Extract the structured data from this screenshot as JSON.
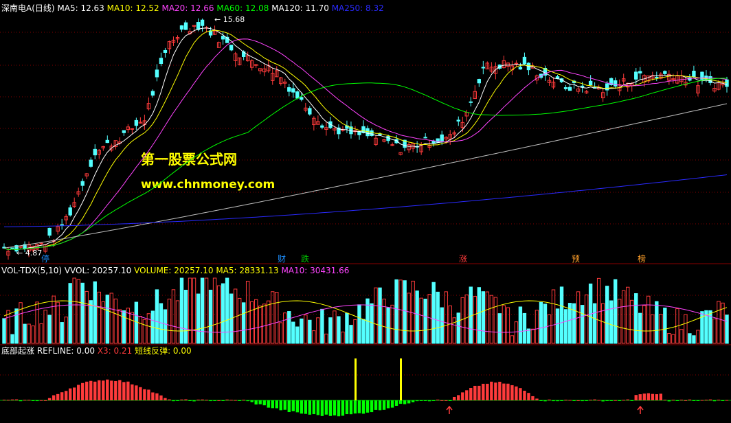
{
  "colors": {
    "bg": "#000000",
    "grid": "#8a0000",
    "up": "#ff3b3b",
    "down": "#54ffff",
    "white": "#ffffff",
    "yellow": "#ffff00",
    "magenta": "#ff44ff",
    "green": "#00ff00",
    "gray": "#c0c0c0",
    "blue": "#2a2aff"
  },
  "price_panel": {
    "stock_name": "深南电A(日线)",
    "ma_labels": [
      "MA5: 12.63",
      "MA10: 12.52",
      "MA20: 12.66",
      "MA60: 12.08",
      "MA120: 11.70",
      "MA250: 8.32"
    ],
    "high_label": "15.68",
    "low_label": "4.87",
    "events": [
      "停",
      "财",
      "跌",
      "涨",
      "预",
      "榜"
    ]
  },
  "volume_panel": {
    "indicator": "VOL-TDX(5,10)",
    "labels": [
      "VVOL: 20257.10",
      "VOLUME: 20257.10",
      "MA5: 28331.13",
      "MA10: 30431.66"
    ]
  },
  "osc_panel": {
    "name": "底部起涨",
    "labels": [
      "REFLINE: 0.00",
      "X3: 0.21",
      "短线反弹: 0.00"
    ]
  },
  "watermark": {
    "line1": "第一股票公式网",
    "line2": "www.chnmoney.com"
  },
  "chart_data": {
    "type": "candlestick",
    "price_range": [
      4.87,
      15.68
    ],
    "max_price": 15.68,
    "min_price": 4.87,
    "last_close_approx": 12.6,
    "ma_current": {
      "MA5": 12.63,
      "MA10": 12.52,
      "MA20": 12.66,
      "MA60": 12.08,
      "MA120": 11.7,
      "MA250": 8.32
    }
  }
}
